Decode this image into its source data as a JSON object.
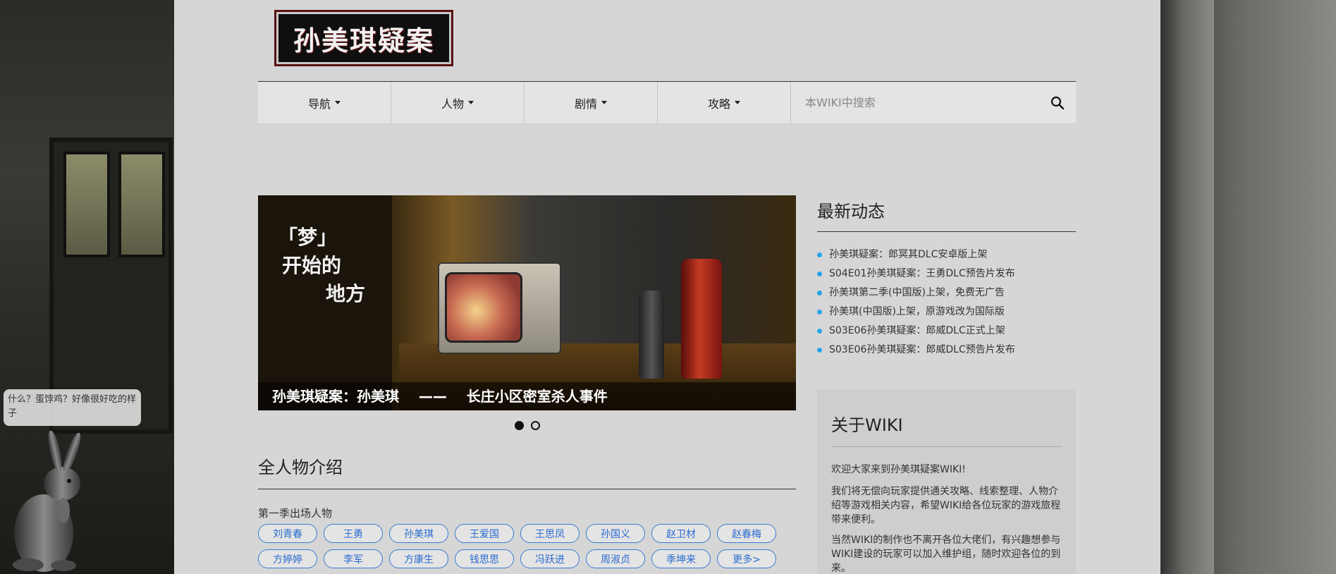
{
  "logo": {
    "text": "孙美琪疑案"
  },
  "nav": {
    "items": [
      {
        "label": "导航"
      },
      {
        "label": "人物"
      },
      {
        "label": "剧情"
      },
      {
        "label": "攻略"
      }
    ],
    "search_placeholder": "本WIKI中搜索"
  },
  "carousel": {
    "headline": [
      "「梦」",
      "开始的",
      "地方"
    ],
    "caption": "孙美琪疑案：孙美琪    ——    长庄小区密室杀人事件",
    "slide_count": 2,
    "active_slide": 1
  },
  "characters": {
    "title": "全人物介绍",
    "season_label": "第一季出场人物",
    "tags": [
      "刘青春",
      "王勇",
      "孙美琪",
      "王爱国",
      "王思凤",
      "孙国义",
      "赵卫材",
      "赵春梅",
      "方婷婷",
      "李军",
      "方康生",
      "钱思思",
      "冯跃进",
      "周淑贞",
      "季坤来",
      "更多>"
    ]
  },
  "news": {
    "title": "最新动态",
    "items": [
      "孙美琪疑案：郎冥其DLC安卓版上架",
      "S04E01孙美琪疑案：王勇DLC预告片发布",
      "孙美琪第二季(中国版)上架，免费无广告",
      "孙美琪(中国版)上架，原游戏改为国际版",
      "S03E06孙美琪疑案：郎威DLC正式上架",
      "S03E06孙美琪疑案：郎威DLC预告片发布"
    ]
  },
  "about": {
    "title": "关于WIKI",
    "p1": "欢迎大家来到孙美琪疑案WIKI!",
    "p2": "我们将无偿向玩家提供通关攻略、线索整理、人物介绍等游戏相关内容，希望WIKI给各位玩家的游戏旅程带来便利。",
    "p3": "当然WIKI的制作也不离开各位大佬们，有兴趣想参与WIKI建设的玩家可以加入维护组，随时欢迎各位的到来。"
  },
  "mascot": {
    "bubble": "什么？蛋饽鸡？好像很好吃的样子"
  }
}
